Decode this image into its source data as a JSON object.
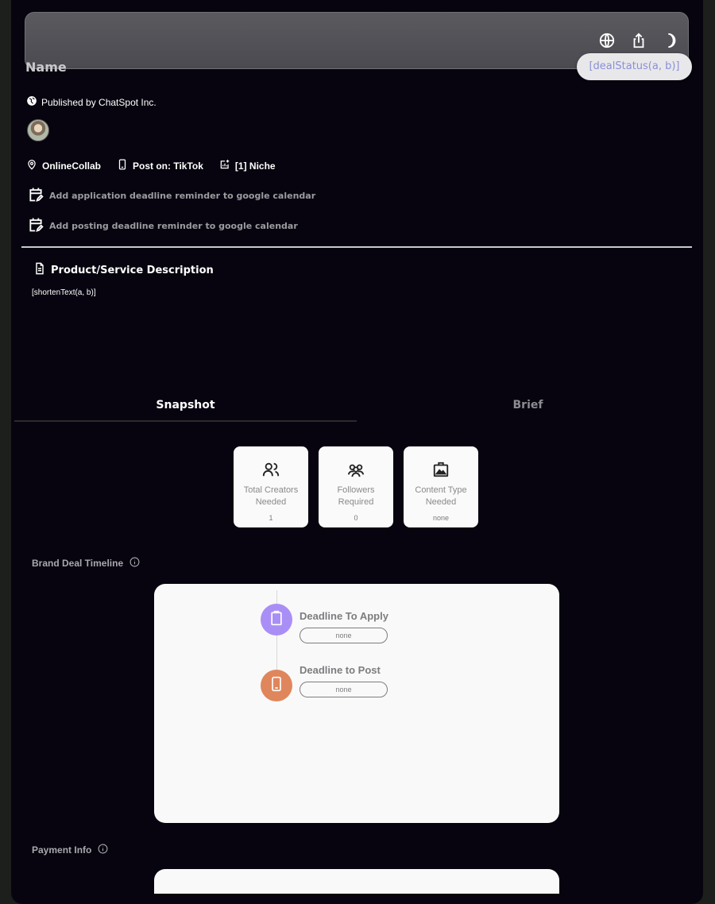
{
  "header": {
    "name": "Name",
    "deal_status": "[dealStatus(a, b)]",
    "icons": [
      "globe-icon",
      "share-icon",
      "moon-icon"
    ]
  },
  "publisher": {
    "text": "Published by ChatSpot Inc."
  },
  "meta": {
    "location": "OnlineCollab",
    "platform": "Post on: TikTok",
    "niche": "[1] Niche"
  },
  "calendar": {
    "application": "Add application deadline reminder to google calendar",
    "posting": "Add posting deadline reminder to google calendar"
  },
  "description": {
    "title": "Product/Service Description",
    "text": "[shortenText(a, b)]"
  },
  "tabs": [
    {
      "label": "Snapshot",
      "active": true
    },
    {
      "label": "Brief",
      "active": false
    }
  ],
  "stats": [
    {
      "label_1": "Total Creators",
      "label_2": "Needed",
      "value": "1",
      "icon": "users-icon"
    },
    {
      "label_1": "Followers",
      "label_2": "Required",
      "value": "0",
      "icon": "followers-icon"
    },
    {
      "label_1": "Content Type",
      "label_2": "Needed",
      "value": "none",
      "icon": "content-type-icon"
    }
  ],
  "timeline": {
    "label": "Brand Deal Timeline",
    "items": [
      {
        "title": "Deadline To Apply",
        "value": "none",
        "color": "#a98ff5",
        "icon": "clipboard-icon"
      },
      {
        "title": "Deadline to Post",
        "value": "none",
        "color": "#e0865c",
        "icon": "phone-icon"
      }
    ]
  },
  "payment": {
    "label": "Payment Info"
  },
  "colors": {
    "background": "#07040f",
    "status_text": "#8a8fd8",
    "apply_dot": "#a98ff5",
    "post_dot": "#e0865c"
  }
}
